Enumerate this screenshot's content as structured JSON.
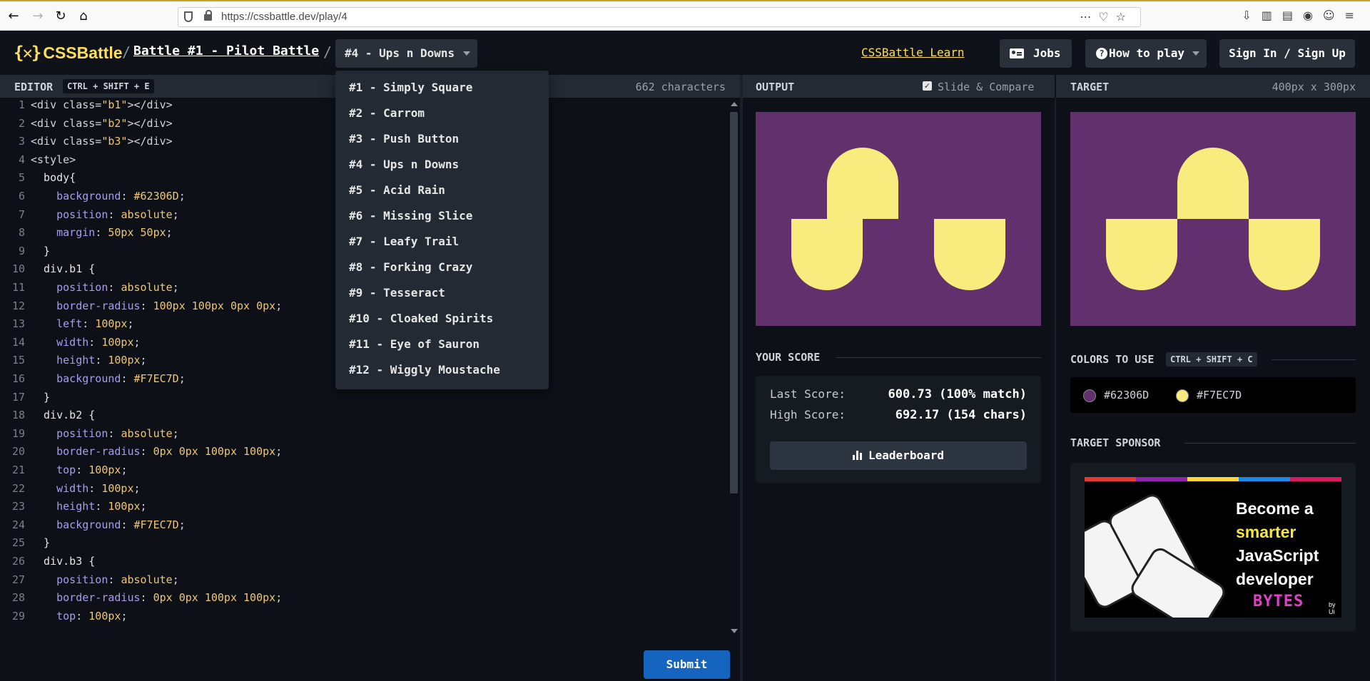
{
  "browser": {
    "url": "https://cssbattle.dev/play/4"
  },
  "header": {
    "logo_mark": "{✕}",
    "logo_text": "CSSBattle",
    "separator": "/",
    "battle_title": "Battle #1 - Pilot Battle",
    "level_selected": "#4 - Ups n Downs",
    "learn_link": "CSSBattle Learn",
    "jobs_label": "Jobs",
    "howto_label": "How to play",
    "signin_label": "Sign In / Sign Up"
  },
  "editor": {
    "title": "EDITOR",
    "shortcut": "CTRL + SHIFT + E",
    "char_count": "662 characters",
    "submit_label": "Submit",
    "lines": [
      "<div class=\"b1\"></div>",
      "<div class=\"b2\"></div>",
      "<div class=\"b3\"></div>",
      "<style>",
      "  body{",
      "    background: #62306D;",
      "    position: absolute;",
      "    margin: 50px 50px;",
      "  }",
      "  div.b1 {",
      "    position: absolute;",
      "    border-radius: 100px 100px 0px 0px;",
      "    left: 100px;",
      "    width: 100px;",
      "    height: 100px;",
      "    background: #F7EC7D;",
      "  }",
      "  div.b2 {",
      "    position: absolute;",
      "    border-radius: 0px 0px 100px 100px;",
      "    top: 100px;",
      "    width: 100px;",
      "    height: 100px;",
      "    background: #F7EC7D;",
      "  }",
      "  div.b3 {",
      "    position: absolute;",
      "    border-radius: 0px 0px 100px 100px;",
      "    top: 100px;"
    ]
  },
  "levels_dropdown": [
    "#1 - Simply Square",
    "#2 - Carrom",
    "#3 - Push Button",
    "#4 - Ups n Downs",
    "#5 - Acid Rain",
    "#6 - Missing Slice",
    "#7 - Leafy Trail",
    "#8 - Forking Crazy",
    "#9 - Tesseract",
    "#10 - Cloaked Spirits",
    "#11 - Eye of Sauron",
    "#12 - Wiggly Moustache"
  ],
  "output": {
    "title": "OUTPUT",
    "slide_compare_label": "Slide & Compare",
    "slide_compare_checked": true
  },
  "target": {
    "title": "TARGET",
    "dimensions": "400px x 300px"
  },
  "score": {
    "title": "YOUR SCORE",
    "last_label": "Last Score:",
    "last_value": "600.73 (100% match)",
    "high_label": "High Score:",
    "high_value": "692.17 (154 chars)",
    "leaderboard_label": "Leaderboard"
  },
  "colors": {
    "title": "COLORS TO USE",
    "shortcut": "CTRL + SHIFT + C",
    "list": [
      "#62306D",
      "#F7EC7D"
    ]
  },
  "sponsor": {
    "title": "TARGET SPONSOR",
    "ad_line1": "Become a",
    "ad_line2": "smarter",
    "ad_line3": "JavaScript",
    "ad_line4": "developer",
    "ad_brand": "BYTES",
    "ad_brand_by": "by Ui"
  },
  "theme": {
    "accent": "#ffde59",
    "canvas_bg": "#62306D",
    "shape_color": "#F7EC7D",
    "submit_blue": "#1565c0"
  }
}
